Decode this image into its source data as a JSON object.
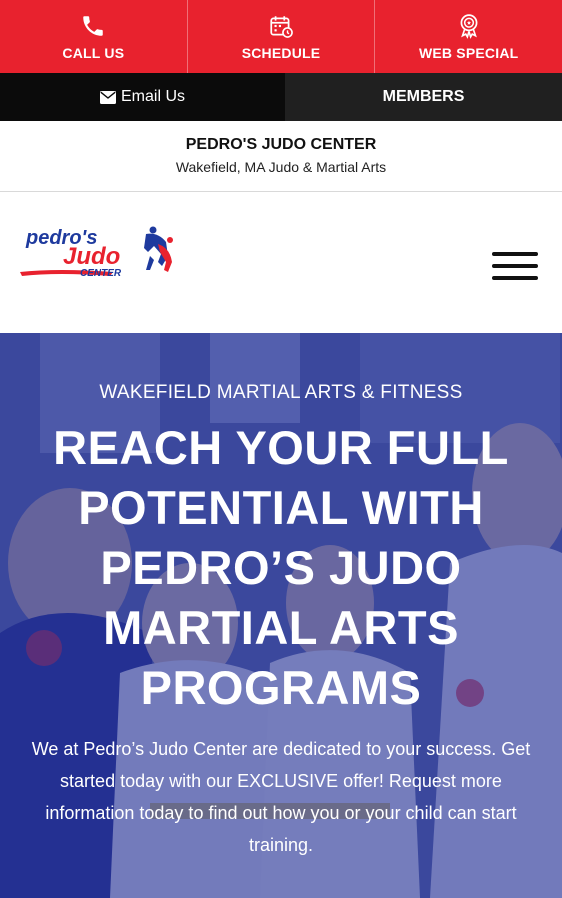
{
  "topbar": {
    "call": {
      "label": "CALL US",
      "icon": "phone-icon"
    },
    "schedule": {
      "label": "SCHEDULE",
      "icon": "calendar-icon"
    },
    "special": {
      "label": "WEB SPECIAL",
      "icon": "award-ribbon-icon"
    }
  },
  "secondbar": {
    "email_label": "Email Us",
    "members_label": "MEMBERS"
  },
  "titleblock": {
    "name": "PEDRO'S JUDO CENTER",
    "tagline": "Wakefield, MA Judo & Martial Arts"
  },
  "logo": {
    "line1": "pedro's",
    "line2": "Judo",
    "line3": "CENTER"
  },
  "hero": {
    "kicker": "WAKEFIELD MARTIAL ARTS & FITNESS",
    "headline": "REACH YOUR FULL POTENTIAL WITH PEDRO’S JUDO MARTIAL ARTS PROGRAMS",
    "description": "We at Pedro’s Judo Center are dedicated to your success. Get started today with our EXCLUSIVE offer! Request more information today to find out how you or your child can start training."
  },
  "colors": {
    "brand_red": "#e8222e",
    "brand_blue": "#1e3a9e",
    "overlay_blue": "#2834a0"
  }
}
